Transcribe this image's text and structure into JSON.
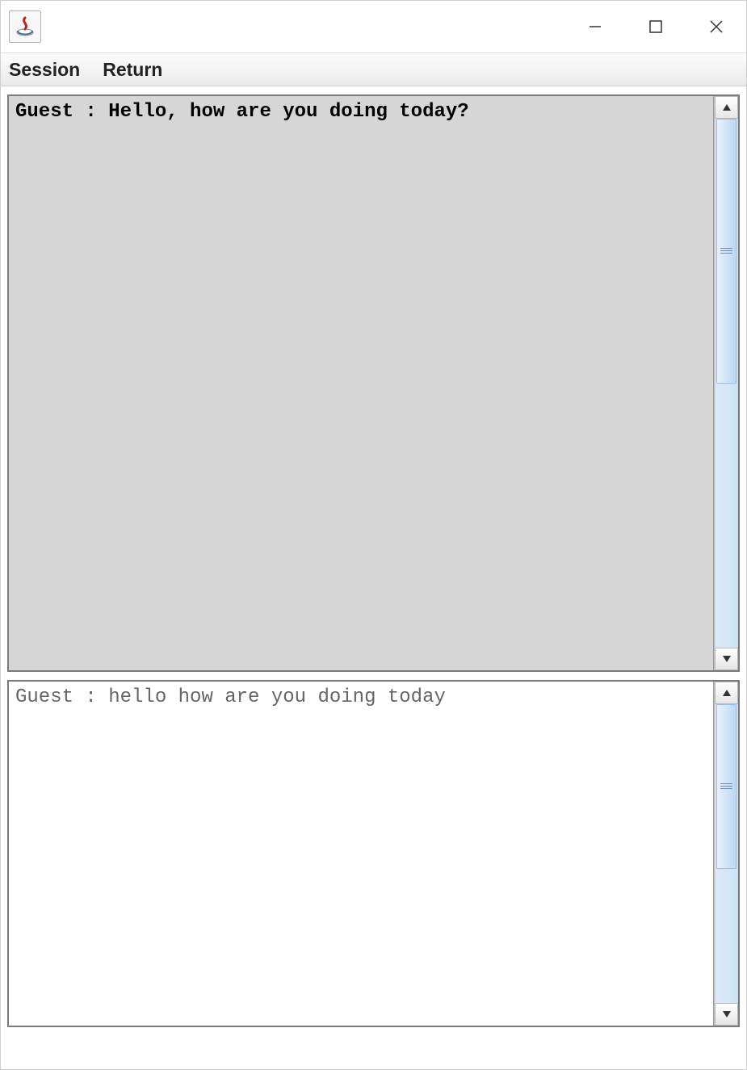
{
  "menu": {
    "session": "Session",
    "return": "Return"
  },
  "chat": {
    "history_text": "Guest : Hello, how are you doing today?",
    "input_text": "Guest : hello how are you doing today"
  }
}
